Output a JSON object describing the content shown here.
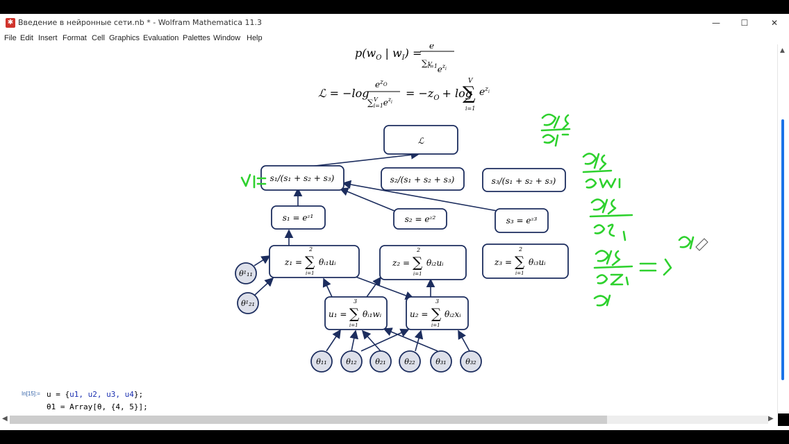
{
  "window": {
    "title": "Введение в нейронные сети.nb * - Wolfram Mathematica 11.3",
    "controls": {
      "minimize": "—",
      "maximize": "☐",
      "close": "✕"
    }
  },
  "menu": [
    "File",
    "Edit",
    "Insert",
    "Format",
    "Cell",
    "Graphics",
    "Evaluation",
    "Palettes",
    "Window",
    "Help"
  ],
  "formulas": {
    "softmax_lhs": "p(w",
    "softmax_sub_o": "O",
    "softmax_mid": " | w",
    "softmax_sub_i": "I",
    "softmax_rhs": ") =",
    "softmax_num": "e",
    "softmax_den": "∑",
    "loss_lhs": "ℒ = −log",
    "loss_num": "e",
    "loss_mid": "= −z",
    "loss_sub": "O",
    "loss_tail": "+ log",
    "loss_sum_top": "V",
    "loss_sum_bottom": "i=1",
    "loss_exp": "e"
  },
  "diagram": {
    "loss_node": "ℒ",
    "norm_nodes": [
      "s₁/(s₁ + s₂ + s₃)",
      "s₂/(s₁ + s₂ + s₃)",
      "s₃/(s₁ + s₂ + s₃)"
    ],
    "exp_nodes": [
      "s₁ = eᶻ¹",
      "s₂ = eᶻ²",
      "s₃ = eᶻ³"
    ],
    "z_nodes": [
      {
        "lhs": "z₁ =",
        "top": "2",
        "bottom": "i=1",
        "rhs": "θᵢ₁uᵢ"
      },
      {
        "lhs": "z₂ =",
        "top": "2",
        "bottom": "i=1",
        "rhs": "θᵢ₂uᵢ"
      },
      {
        "lhs": "z₃ =",
        "top": "2",
        "bottom": "i=1",
        "rhs": "θᵢ₃uᵢ"
      }
    ],
    "u_nodes": [
      {
        "lhs": "u₁ =",
        "top": "3",
        "bottom": "i=1",
        "rhs": "θᵢ₁wᵢ"
      },
      {
        "lhs": "u₂ =",
        "top": "3",
        "bottom": "i=1",
        "rhs": "θᵢ₂xᵢ"
      }
    ],
    "theta_top": [
      "θ¹₁₁",
      "θ¹₂₁"
    ],
    "theta_bottom": [
      "θ₁₁",
      "θ₁₂",
      "θ₂₁",
      "θ₂₂",
      "θ₃₁",
      "θ₃₂"
    ]
  },
  "input_cell": {
    "label": "In[15]:=",
    "line1_prefix": "u = {",
    "line1_vars": "u1, u2, u3, u4",
    "line1_suffix": "};",
    "line2": "θ1 = Array[θ, {4, 5}];"
  },
  "colors": {
    "node_border": "#1c2d5e",
    "node_fill_circle": "#dde0ea",
    "annotation_green": "#2ed12e",
    "scroll_accent": "#1a73e8"
  }
}
